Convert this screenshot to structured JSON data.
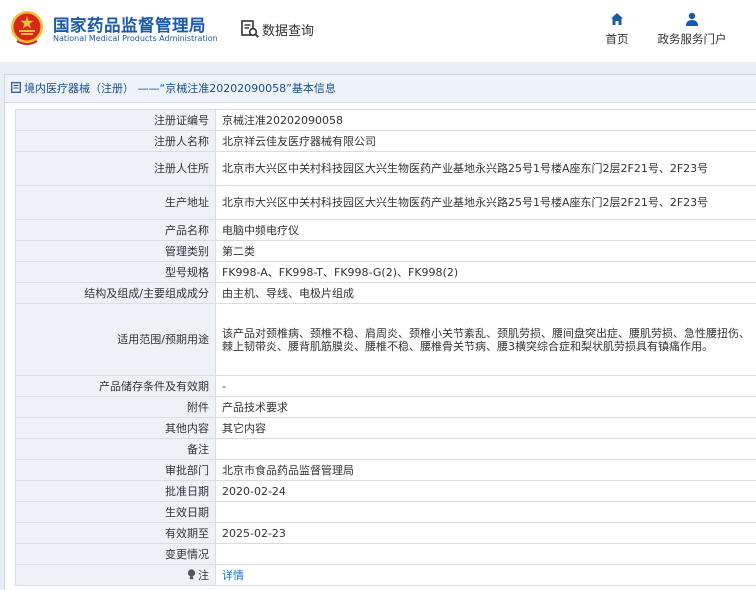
{
  "header": {
    "org_name_cn": "国家药品监督管理局",
    "org_name_en": "National Medical Products Administration",
    "query_label": "数据查询",
    "nav": [
      {
        "label": "首页",
        "icon": "home-icon"
      },
      {
        "label": "政务服务门户",
        "icon": "user-icon"
      }
    ]
  },
  "breadcrumb": "境内医疗器械（注册） ——“京械注准20202090058”基本信息",
  "rows": [
    {
      "label": "注册证编号",
      "value": "京械注准20202090058"
    },
    {
      "label": "注册人名称",
      "value": "北京祥云佳友医疗器械有限公司"
    },
    {
      "label": "注册人住所",
      "value": "北京市大兴区中关村科技园区大兴生物医药产业基地永兴路25号1号楼A座东门2层2F21号、2F23号"
    },
    {
      "label": "生产地址",
      "value": "北京市大兴区中关村科技园区大兴生物医药产业基地永兴路25号1号楼A座东门2层2F21号、2F23号"
    },
    {
      "label": "产品名称",
      "value": "电脑中频电疗仪"
    },
    {
      "label": "管理类别",
      "value": "第二类"
    },
    {
      "label": "型号规格",
      "value": "FK998-A、FK998-T、FK998-G(2)、FK998(2)"
    },
    {
      "label": "结构及组成/主要组成成分",
      "value": "由主机、导线、电极片组成"
    },
    {
      "label": "适用范围/预期用途",
      "value": "该产品对颈椎病、颈椎不稳、肩周炎、颈椎小关节紊乱、颈肌劳损、腰间盘突出症、腰肌劳损、急性腰扭伤、棘上韧带炎、腰背肌筋膜炎、腰椎不稳、腰椎骨关节病、腰3横突综合症和梨状肌劳损具有镇痛作用。"
    },
    {
      "label": "产品储存条件及有效期",
      "value": "-"
    },
    {
      "label": "附件",
      "value": "产品技术要求"
    },
    {
      "label": "其他内容",
      "value": "其它内容"
    },
    {
      "label": "备注",
      "value": ""
    },
    {
      "label": "审批部门",
      "value": "北京市食品药品监督管理局"
    },
    {
      "label": "批准日期",
      "value": "2020-02-24"
    },
    {
      "label": "生效日期",
      "value": ""
    },
    {
      "label": "有效期至",
      "value": "2025-02-23"
    },
    {
      "label": "变更情况",
      "value": ""
    },
    {
      "label": "注",
      "value": "详情"
    }
  ],
  "colors": {
    "brand_blue": "#1a5aa6",
    "link_blue": "#1a73c4",
    "label_bg": "#eef2f6",
    "frame_bg": "#e8eef4",
    "emblem_red": "#d8261f",
    "emblem_gold": "#f2c12e"
  }
}
